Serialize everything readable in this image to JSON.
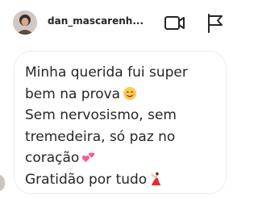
{
  "header": {
    "username": "dan_mascarenh...",
    "avatar_icon": "profile-photo",
    "video_icon": "video-camera-icon",
    "flag_icon": "flag-icon"
  },
  "message": {
    "lines": [
      "Minha querida fui super",
      "bem na prova",
      "Sem nervosismo, sem",
      "tremedeira, só paz no",
      "coração",
      "Gratidão por tudo"
    ],
    "emojis": [
      "smiling-face-emoji",
      "two-hearts-emoji",
      "dancer-emoji"
    ]
  },
  "colors": {
    "text": "#262626",
    "bubble_border": "#ebebeb",
    "background": "#ffffff"
  }
}
